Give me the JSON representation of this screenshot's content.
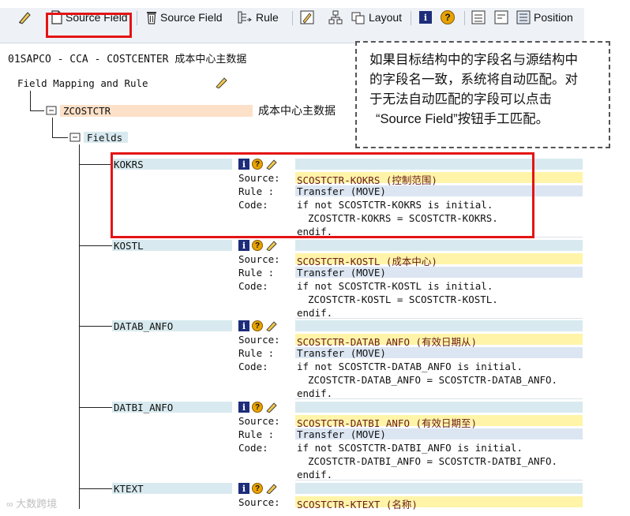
{
  "toolbar": {
    "source_field_create": "Source Field",
    "source_field_delete": "Source Field",
    "rule": "Rule",
    "layout": "Layout",
    "position": "Position"
  },
  "header": {
    "path": "01SAPCO - CCA - COSTCENTER 成本中心主数据",
    "tree_root": "Field Mapping and Rule",
    "structure": "ZCOSTCTR",
    "structure_desc": "成本中心主数据",
    "fields_node": "Fields"
  },
  "callout": {
    "line1": "如果目标结构中的字段名与源结构中",
    "line2": "的字段名一致，系统将自动匹配。对",
    "line3": "于无法自动匹配的字段可以点击",
    "line4": "“Source Field”按钮手工匹配。"
  },
  "labels": {
    "source": "Source:",
    "rule": "Rule :",
    "code": "Code:"
  },
  "fields": [
    {
      "name": "KOKRS",
      "source": "SCOSTCTR-KOKRS (控制范围)",
      "rule": "Transfer (MOVE)",
      "code1": "if not SCOSTCTR-KOKRS is initial.",
      "code2": "ZCOSTCTR-KOKRS = SCOSTCTR-KOKRS.",
      "code3": "endif."
    },
    {
      "name": "KOSTL",
      "source": "SCOSTCTR-KOSTL (成本中心)",
      "rule": "Transfer (MOVE)",
      "code1": "if not SCOSTCTR-KOSTL is initial.",
      "code2": "ZCOSTCTR-KOSTL = SCOSTCTR-KOSTL.",
      "code3": "endif."
    },
    {
      "name": "DATAB_ANFO",
      "source": "SCOSTCTR-DATAB_ANFO (有效日期从)",
      "rule": "Transfer (MOVE)",
      "code1": "if not SCOSTCTR-DATAB_ANFO is initial.",
      "code2": "ZCOSTCTR-DATAB_ANFO = SCOSTCTR-DATAB_ANFO.",
      "code3": "endif."
    },
    {
      "name": "DATBI_ANFO",
      "source": "SCOSTCTR-DATBI_ANFO (有效日期至)",
      "rule": "Transfer (MOVE)",
      "code1": "if not SCOSTCTR-DATBI_ANFO is initial.",
      "code2": "ZCOSTCTR-DATBI_ANFO = SCOSTCTR-DATBI_ANFO.",
      "code3": "endif."
    },
    {
      "name": "KTEXT",
      "source": "SCOSTCTR-KTEXT (名称)"
    }
  ],
  "watermark": "大数跨境",
  "colors": {
    "highlight": "#e41414",
    "field_bar": "#d8eaef",
    "source_bar": "#fff4a8",
    "rule_bar": "#dce6f2",
    "structure_bar": "#fde0c8"
  }
}
